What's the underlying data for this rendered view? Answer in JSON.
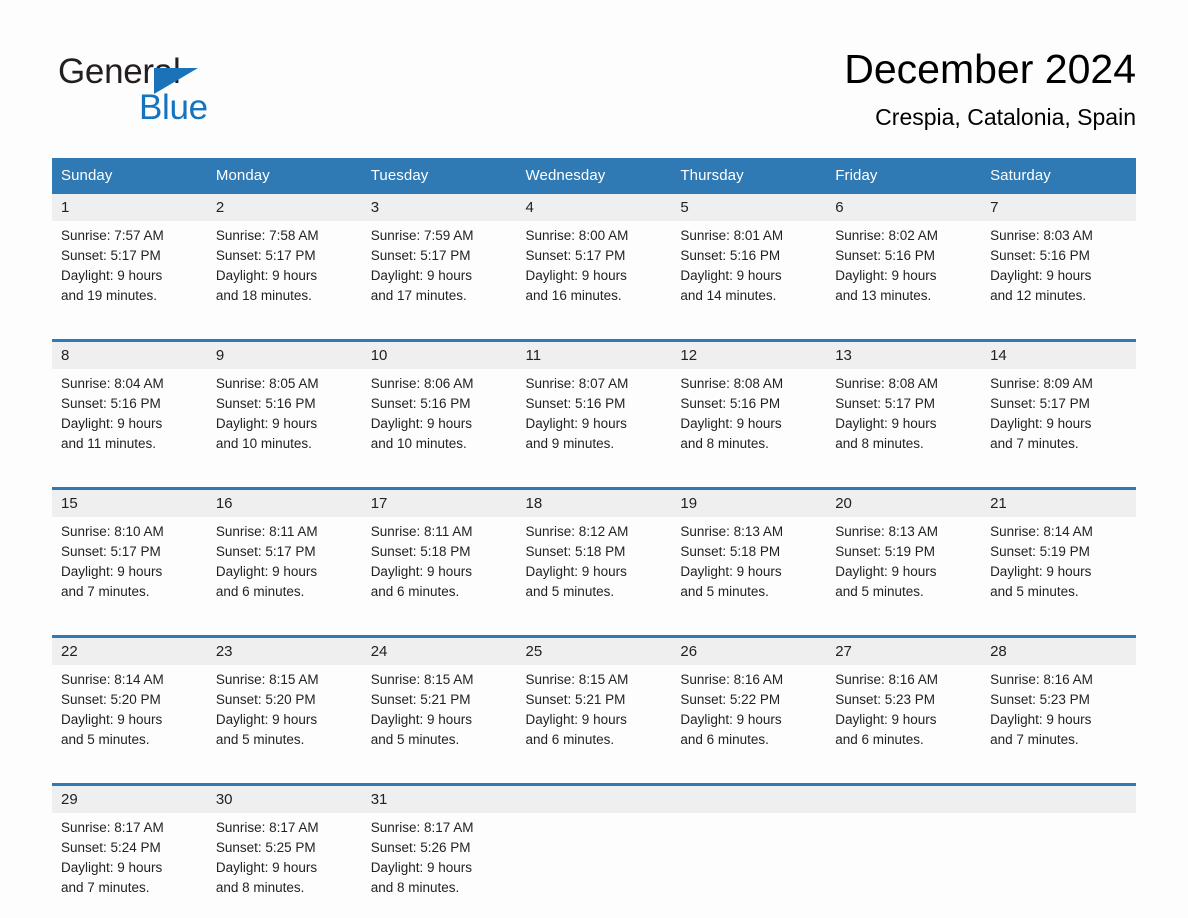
{
  "brand": {
    "name_part1": "General",
    "name_part2": "Blue",
    "triangle_color": "#1a72b8",
    "text_color": "#231f20",
    "accent_color": "#1574bf"
  },
  "header": {
    "title": "December 2024",
    "subtitle": "Crespia, Catalonia, Spain"
  },
  "theme": {
    "header_bar_color": "#2f7ab5",
    "daynum_band_color": "#efefef",
    "cell_bg_color": "#fdfdfd",
    "row_border_color": "#2f7ab5"
  },
  "weekdays": [
    "Sunday",
    "Monday",
    "Tuesday",
    "Wednesday",
    "Thursday",
    "Friday",
    "Saturday"
  ],
  "labels": {
    "sunrise_prefix": "Sunrise:",
    "sunset_prefix": "Sunset:",
    "daylight_prefix": "Daylight:"
  },
  "weeks": [
    [
      {
        "day": "1",
        "sunrise": "Sunrise: 7:57 AM",
        "sunset": "Sunset: 5:17 PM",
        "daylight_1": "Daylight: 9 hours",
        "daylight_2": "and 19 minutes."
      },
      {
        "day": "2",
        "sunrise": "Sunrise: 7:58 AM",
        "sunset": "Sunset: 5:17 PM",
        "daylight_1": "Daylight: 9 hours",
        "daylight_2": "and 18 minutes."
      },
      {
        "day": "3",
        "sunrise": "Sunrise: 7:59 AM",
        "sunset": "Sunset: 5:17 PM",
        "daylight_1": "Daylight: 9 hours",
        "daylight_2": "and 17 minutes."
      },
      {
        "day": "4",
        "sunrise": "Sunrise: 8:00 AM",
        "sunset": "Sunset: 5:17 PM",
        "daylight_1": "Daylight: 9 hours",
        "daylight_2": "and 16 minutes."
      },
      {
        "day": "5",
        "sunrise": "Sunrise: 8:01 AM",
        "sunset": "Sunset: 5:16 PM",
        "daylight_1": "Daylight: 9 hours",
        "daylight_2": "and 14 minutes."
      },
      {
        "day": "6",
        "sunrise": "Sunrise: 8:02 AM",
        "sunset": "Sunset: 5:16 PM",
        "daylight_1": "Daylight: 9 hours",
        "daylight_2": "and 13 minutes."
      },
      {
        "day": "7",
        "sunrise": "Sunrise: 8:03 AM",
        "sunset": "Sunset: 5:16 PM",
        "daylight_1": "Daylight: 9 hours",
        "daylight_2": "and 12 minutes."
      }
    ],
    [
      {
        "day": "8",
        "sunrise": "Sunrise: 8:04 AM",
        "sunset": "Sunset: 5:16 PM",
        "daylight_1": "Daylight: 9 hours",
        "daylight_2": "and 11 minutes."
      },
      {
        "day": "9",
        "sunrise": "Sunrise: 8:05 AM",
        "sunset": "Sunset: 5:16 PM",
        "daylight_1": "Daylight: 9 hours",
        "daylight_2": "and 10 minutes."
      },
      {
        "day": "10",
        "sunrise": "Sunrise: 8:06 AM",
        "sunset": "Sunset: 5:16 PM",
        "daylight_1": "Daylight: 9 hours",
        "daylight_2": "and 10 minutes."
      },
      {
        "day": "11",
        "sunrise": "Sunrise: 8:07 AM",
        "sunset": "Sunset: 5:16 PM",
        "daylight_1": "Daylight: 9 hours",
        "daylight_2": "and 9 minutes."
      },
      {
        "day": "12",
        "sunrise": "Sunrise: 8:08 AM",
        "sunset": "Sunset: 5:16 PM",
        "daylight_1": "Daylight: 9 hours",
        "daylight_2": "and 8 minutes."
      },
      {
        "day": "13",
        "sunrise": "Sunrise: 8:08 AM",
        "sunset": "Sunset: 5:17 PM",
        "daylight_1": "Daylight: 9 hours",
        "daylight_2": "and 8 minutes."
      },
      {
        "day": "14",
        "sunrise": "Sunrise: 8:09 AM",
        "sunset": "Sunset: 5:17 PM",
        "daylight_1": "Daylight: 9 hours",
        "daylight_2": "and 7 minutes."
      }
    ],
    [
      {
        "day": "15",
        "sunrise": "Sunrise: 8:10 AM",
        "sunset": "Sunset: 5:17 PM",
        "daylight_1": "Daylight: 9 hours",
        "daylight_2": "and 7 minutes."
      },
      {
        "day": "16",
        "sunrise": "Sunrise: 8:11 AM",
        "sunset": "Sunset: 5:17 PM",
        "daylight_1": "Daylight: 9 hours",
        "daylight_2": "and 6 minutes."
      },
      {
        "day": "17",
        "sunrise": "Sunrise: 8:11 AM",
        "sunset": "Sunset: 5:18 PM",
        "daylight_1": "Daylight: 9 hours",
        "daylight_2": "and 6 minutes."
      },
      {
        "day": "18",
        "sunrise": "Sunrise: 8:12 AM",
        "sunset": "Sunset: 5:18 PM",
        "daylight_1": "Daylight: 9 hours",
        "daylight_2": "and 5 minutes."
      },
      {
        "day": "19",
        "sunrise": "Sunrise: 8:13 AM",
        "sunset": "Sunset: 5:18 PM",
        "daylight_1": "Daylight: 9 hours",
        "daylight_2": "and 5 minutes."
      },
      {
        "day": "20",
        "sunrise": "Sunrise: 8:13 AM",
        "sunset": "Sunset: 5:19 PM",
        "daylight_1": "Daylight: 9 hours",
        "daylight_2": "and 5 minutes."
      },
      {
        "day": "21",
        "sunrise": "Sunrise: 8:14 AM",
        "sunset": "Sunset: 5:19 PM",
        "daylight_1": "Daylight: 9 hours",
        "daylight_2": "and 5 minutes."
      }
    ],
    [
      {
        "day": "22",
        "sunrise": "Sunrise: 8:14 AM",
        "sunset": "Sunset: 5:20 PM",
        "daylight_1": "Daylight: 9 hours",
        "daylight_2": "and 5 minutes."
      },
      {
        "day": "23",
        "sunrise": "Sunrise: 8:15 AM",
        "sunset": "Sunset: 5:20 PM",
        "daylight_1": "Daylight: 9 hours",
        "daylight_2": "and 5 minutes."
      },
      {
        "day": "24",
        "sunrise": "Sunrise: 8:15 AM",
        "sunset": "Sunset: 5:21 PM",
        "daylight_1": "Daylight: 9 hours",
        "daylight_2": "and 5 minutes."
      },
      {
        "day": "25",
        "sunrise": "Sunrise: 8:15 AM",
        "sunset": "Sunset: 5:21 PM",
        "daylight_1": "Daylight: 9 hours",
        "daylight_2": "and 6 minutes."
      },
      {
        "day": "26",
        "sunrise": "Sunrise: 8:16 AM",
        "sunset": "Sunset: 5:22 PM",
        "daylight_1": "Daylight: 9 hours",
        "daylight_2": "and 6 minutes."
      },
      {
        "day": "27",
        "sunrise": "Sunrise: 8:16 AM",
        "sunset": "Sunset: 5:23 PM",
        "daylight_1": "Daylight: 9 hours",
        "daylight_2": "and 6 minutes."
      },
      {
        "day": "28",
        "sunrise": "Sunrise: 8:16 AM",
        "sunset": "Sunset: 5:23 PM",
        "daylight_1": "Daylight: 9 hours",
        "daylight_2": "and 7 minutes."
      }
    ],
    [
      {
        "day": "29",
        "sunrise": "Sunrise: 8:17 AM",
        "sunset": "Sunset: 5:24 PM",
        "daylight_1": "Daylight: 9 hours",
        "daylight_2": "and 7 minutes."
      },
      {
        "day": "30",
        "sunrise": "Sunrise: 8:17 AM",
        "sunset": "Sunset: 5:25 PM",
        "daylight_1": "Daylight: 9 hours",
        "daylight_2": "and 8 minutes."
      },
      {
        "day": "31",
        "sunrise": "Sunrise: 8:17 AM",
        "sunset": "Sunset: 5:26 PM",
        "daylight_1": "Daylight: 9 hours",
        "daylight_2": "and 8 minutes."
      },
      {
        "day": "",
        "sunrise": "",
        "sunset": "",
        "daylight_1": "",
        "daylight_2": ""
      },
      {
        "day": "",
        "sunrise": "",
        "sunset": "",
        "daylight_1": "",
        "daylight_2": ""
      },
      {
        "day": "",
        "sunrise": "",
        "sunset": "",
        "daylight_1": "",
        "daylight_2": ""
      },
      {
        "day": "",
        "sunrise": "",
        "sunset": "",
        "daylight_1": "",
        "daylight_2": ""
      }
    ]
  ]
}
